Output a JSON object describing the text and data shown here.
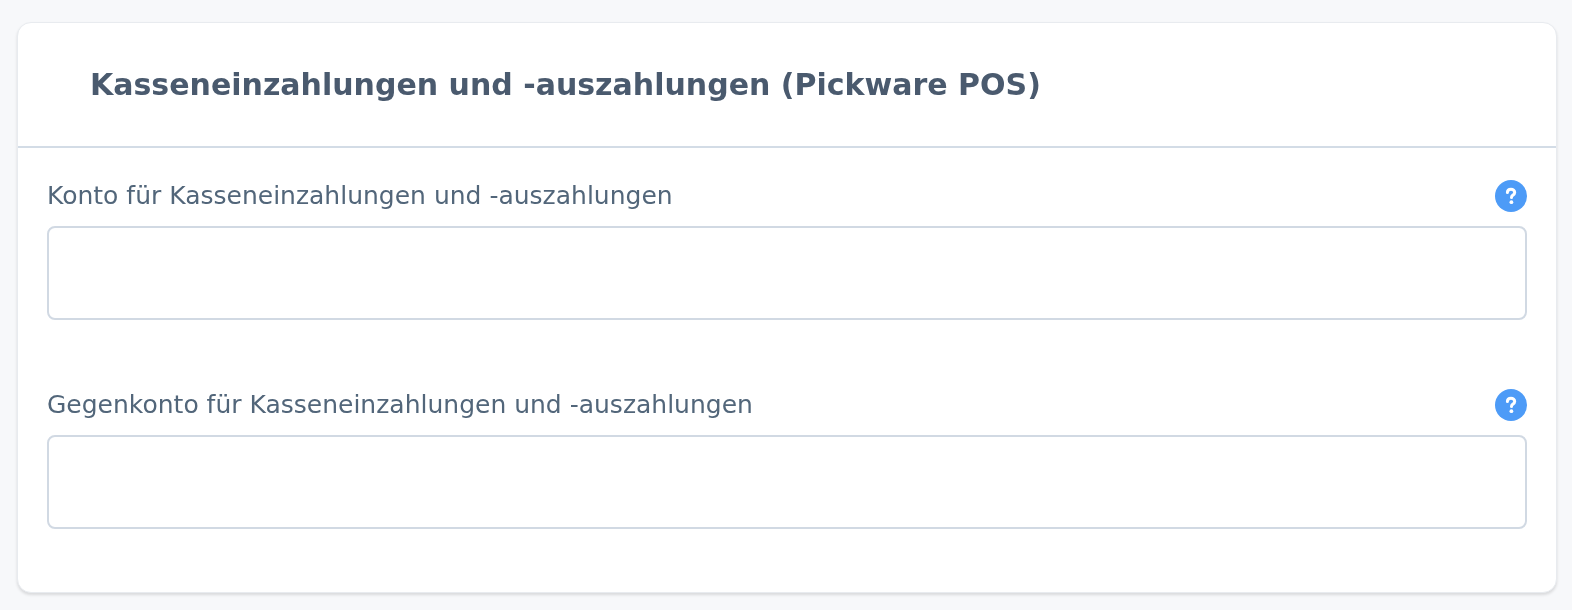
{
  "card": {
    "title": "Kasseneinzahlungen und -auszahlungen (Pickware POS)"
  },
  "fields": [
    {
      "label": "Konto für Kasseneinzahlungen und -auszahlungen"
    },
    {
      "label": "Gegenkonto für Kasseneinzahlungen und -auszahlungen"
    }
  ]
}
